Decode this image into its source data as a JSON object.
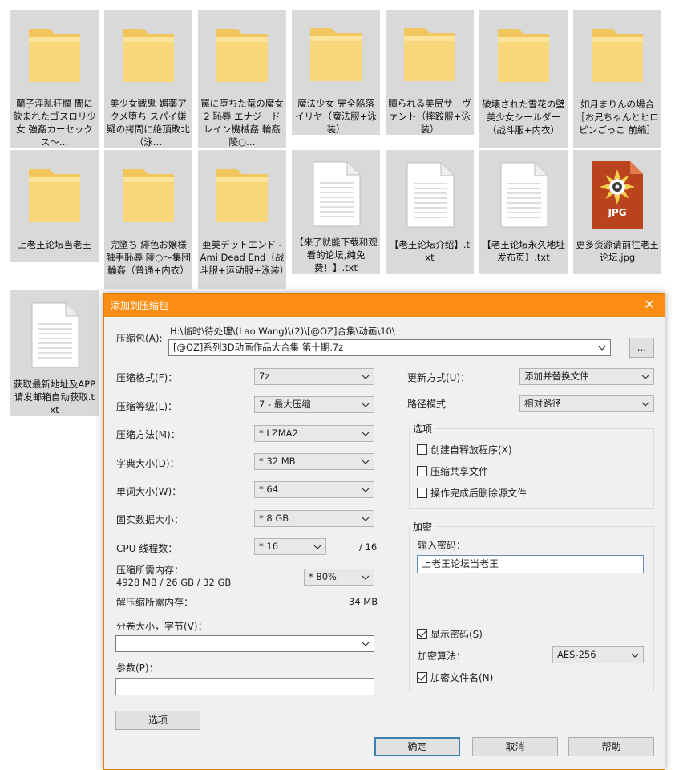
{
  "files": [
    {
      "label": "蘭子淫乱狂欄 間に飲まれたゴスロリ少女 強姦カーセックス～…",
      "type": "folder"
    },
    {
      "label": "美少女戦鬼 媚薬アクメ堕ち スパイ嫌疑の拷問に絶頂敗北（泳…",
      "type": "folder"
    },
    {
      "label": "罠に堕ちた竜の魔女2 恥辱 エナジードレイン機械姦 輪姦陵○…",
      "type": "folder"
    },
    {
      "label": "魔法少女 完全陥落 イリヤ（魔法服+泳装）",
      "type": "folder"
    },
    {
      "label": "贖られる美尻サーヴァント（摔跤服+泳装）",
      "type": "folder"
    },
    {
      "label": "破壊された雪花の壁 美少女シールダー（战斗服+内衣）",
      "type": "folder"
    },
    {
      "label": "如月まりんの場合［お兄ちゃんとヒロピンごっこ 前編］",
      "type": "folder"
    },
    {
      "label": "上老王论坛当老王",
      "type": "folder"
    },
    {
      "label": "完墮ち 緋色お嬢様 触手恥辱 陵○～集団輪姦（普通+内衣）",
      "type": "folder"
    },
    {
      "label": "亜美デットエンド - Ami Dead End（战斗服+运动服+泳装）",
      "type": "folder"
    },
    {
      "label": "【来了就能下载和观看的论坛,纯免费！】.txt",
      "type": "txt"
    },
    {
      "label": "【老王论坛介绍】.txt",
      "type": "txt"
    },
    {
      "label": "【老王论坛永久地址发布页】.txt",
      "type": "txt"
    },
    {
      "label": "更多资源请前往老王论坛.jpg",
      "type": "jpg",
      "badge": "JPG"
    },
    {
      "label": "获取最新地址及APP请发邮箱自动获取.txt",
      "type": "txt"
    }
  ],
  "dialog": {
    "title": "添加到压缩包",
    "archive_label": "压缩包(A):",
    "archive_path": "H:\\临时\\待处理\\(Lao Wang)\\(2)\\[@OZ]合集\\动画\\10\\",
    "archive_name": "[@OZ]系列3D动画作品大合集 第十期.7z",
    "browse_label": "...",
    "left": {
      "format_label": "压缩格式(F)：",
      "format_value": "7z",
      "level_label": "压缩等级(L)：",
      "level_value": "7 - 最大压缩",
      "method_label": "压缩方法(M)：",
      "method_value": "* LZMA2",
      "dict_label": "字典大小(D)：",
      "dict_value": "* 32 MB",
      "word_label": "单词大小(W)：",
      "word_value": "* 64",
      "solid_label": "固实数据大小：",
      "solid_value": "* 8 GB",
      "cpu_label": "CPU 线程数：",
      "cpu_value": "* 16",
      "cpu_total": "/ 16",
      "mem_label": "压缩所需内存：",
      "mem_detail": "4928 MB / 26 GB / 32 GB",
      "mem_percent": "* 80%",
      "decomp_label": "解压缩所需内存：",
      "decomp_value": "34 MB",
      "volume_label": "分卷大小，字节(V)：",
      "volume_value": "",
      "params_label": "参数(P)：",
      "params_value": "",
      "options_button": "选项"
    },
    "right": {
      "update_label": "更新方式(U)：",
      "update_value": "添加并替换文件",
      "path_label": "路径模式",
      "path_value": "相对路径",
      "options_group": "选项",
      "opt_sfx": "创建自释放程序(X)",
      "opt_shared": "压缩共享文件",
      "opt_delete": "操作完成后删除源文件",
      "enc_group": "加密",
      "password_label": "输入密码：",
      "password_value": "上老王论坛当老王",
      "show_password": "显示密码(S)",
      "enc_method_label": "加密算法：",
      "enc_method_value": "AES-256",
      "enc_names": "加密文件名(N)"
    },
    "buttons": {
      "ok": "确定",
      "cancel": "取消",
      "help": "帮助"
    }
  }
}
